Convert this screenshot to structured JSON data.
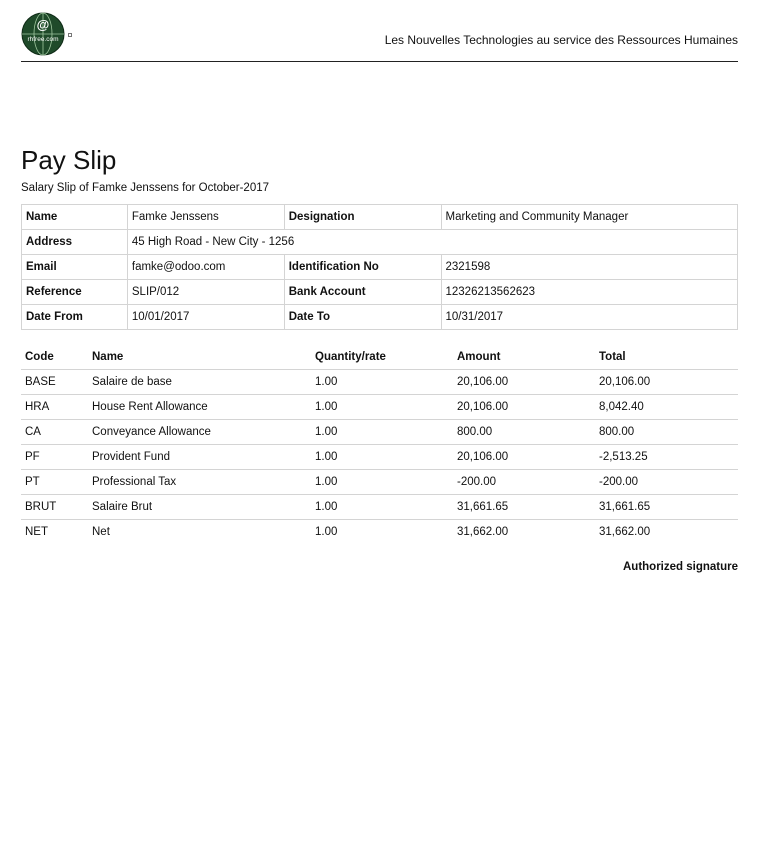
{
  "header": {
    "logo_text": "rhfree.com",
    "logo_symbol": "@",
    "tagline": "Les Nouvelles Technologies au service des Ressources Humaines"
  },
  "title": "Pay Slip",
  "subtitle": "Salary Slip of Famke Jenssens for October-2017",
  "employee": {
    "name_label": "Name",
    "name": "Famke Jenssens",
    "designation_label": "Designation",
    "designation": "Marketing and Community Manager",
    "address_label": "Address",
    "address": "45 High Road - New City - 1256",
    "email_label": "Email",
    "email": "famke@odoo.com",
    "identification_label": "Identification No",
    "identification": "2321598",
    "reference_label": "Reference",
    "reference": "SLIP/012",
    "bank_label": "Bank Account",
    "bank": "12326213562623",
    "date_from_label": "Date From",
    "date_from": "10/01/2017",
    "date_to_label": "Date To",
    "date_to": "10/31/2017"
  },
  "lines": {
    "headers": [
      "Code",
      "Name",
      "Quantity/rate",
      "Amount",
      "Total"
    ],
    "rows": [
      {
        "code": "BASE",
        "name": "Salaire de base",
        "qty": "1.00",
        "amount": "20,106.00",
        "total": "20,106.00"
      },
      {
        "code": "HRA",
        "name": "House Rent Allowance",
        "qty": "1.00",
        "amount": "20,106.00",
        "total": "8,042.40"
      },
      {
        "code": "CA",
        "name": "Conveyance Allowance",
        "qty": "1.00",
        "amount": "800.00",
        "total": "800.00"
      },
      {
        "code": "PF",
        "name": "Provident Fund",
        "qty": "1.00",
        "amount": "20,106.00",
        "total": "-2,513.25"
      },
      {
        "code": "PT",
        "name": "Professional Tax",
        "qty": "1.00",
        "amount": "-200.00",
        "total": "-200.00"
      },
      {
        "code": "BRUT",
        "name": "Salaire Brut",
        "qty": "1.00",
        "amount": "31,661.65",
        "total": "31,661.65"
      },
      {
        "code": "NET",
        "name": "Net",
        "qty": "1.00",
        "amount": "31,662.00",
        "total": "31,662.00"
      }
    ]
  },
  "signature": "Authorized signature"
}
